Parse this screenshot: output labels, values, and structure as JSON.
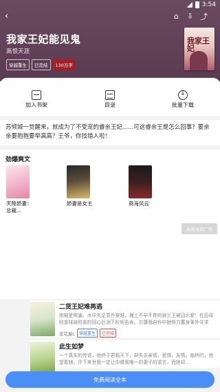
{
  "status_bar": {
    "time": "3:54"
  },
  "book": {
    "title": "我家王妃能见鬼",
    "author": "离恨天涯",
    "tags": [
      "穿越重生",
      "已完结",
      "130万字"
    ],
    "cover_text": "我家王妃"
  },
  "actions": [
    {
      "label": "加入书架",
      "icon": "bookshelf-icon"
    },
    {
      "label": "目录",
      "icon": "catalog-icon"
    },
    {
      "label": "批量下载",
      "icon": "cloud-download-icon"
    }
  ],
  "intro": "苏倾城一觉醒来，就成为了不受宠的睿亲王妃......可这睿亲王是怎么回事？要亲亲要抱抱要举高高？王爷，你找错人啦！",
  "recommend": {
    "title": "劲爆爽文",
    "items": [
      {
        "name": "天降娇妻：总裁..."
      },
      {
        "name": "娇妻是女主"
      },
      {
        "name": "商海风云"
      }
    ]
  },
  "close_ad_label": "关闭当前广告",
  "list": [
    {
      "title": "二货王妃难再逃",
      "desc": "她被爱欺骗，水中失足意外穿越，撞上不孕不育的纳兰王被囚示爱！在后母陷害妹妹陷害的同心巨测下阶矩告命。尔康我自作中她努力蓄身事外寻求自...",
      "author": "安花屋L",
      "tags": [
        "穿越重生",
        "已完结"
      ]
    },
    {
      "title": "此生如梦",
      "desc": "一个真实的传说，他终于君临天下，却失去亲情，爱情，友情。临终时，他望着她，许下来世我一定让你做我唯一的妻子的诺言，而她却..."
    }
  ],
  "read_button": "免费阅读全本"
}
